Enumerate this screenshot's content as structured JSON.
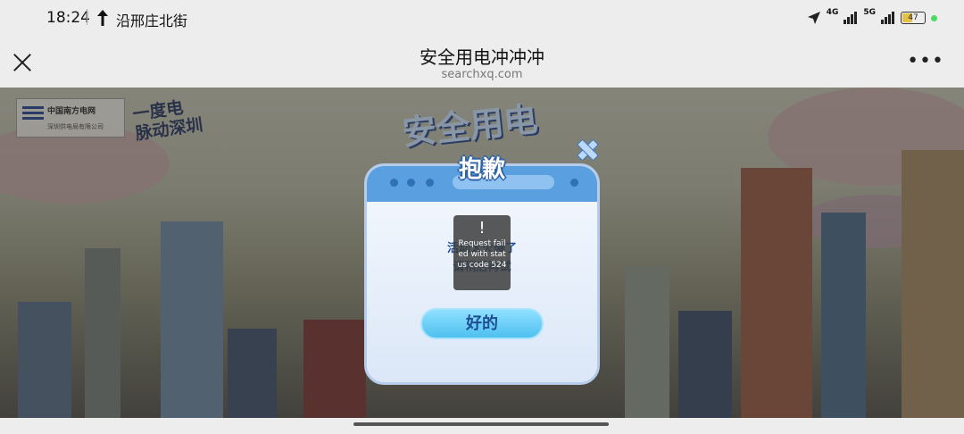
{
  "status_bar": {
    "time": "18:24",
    "location": "沿邢庄北街",
    "network_1": "4G",
    "network_2": "5G",
    "battery": "47"
  },
  "header": {
    "title": "安全用电冲冲冲",
    "url": "searchxq.com"
  },
  "scene": {
    "logo_main": "中国南方电网",
    "logo_sub": "深圳供电局有限公司",
    "slogan_1": "一度电",
    "slogan_2": "脉动深圳",
    "game_title": "安全用电"
  },
  "dialog": {
    "heading": "抱歉",
    "message_line1": "活动太火爆了",
    "message_line2": "请稍后再试",
    "ok_label": "好的"
  },
  "toast": {
    "icon": "!",
    "text": "Request failed with status code 524"
  },
  "colors": {
    "dialog_header": "#5a9fe0",
    "button": "#4fc1ef"
  }
}
